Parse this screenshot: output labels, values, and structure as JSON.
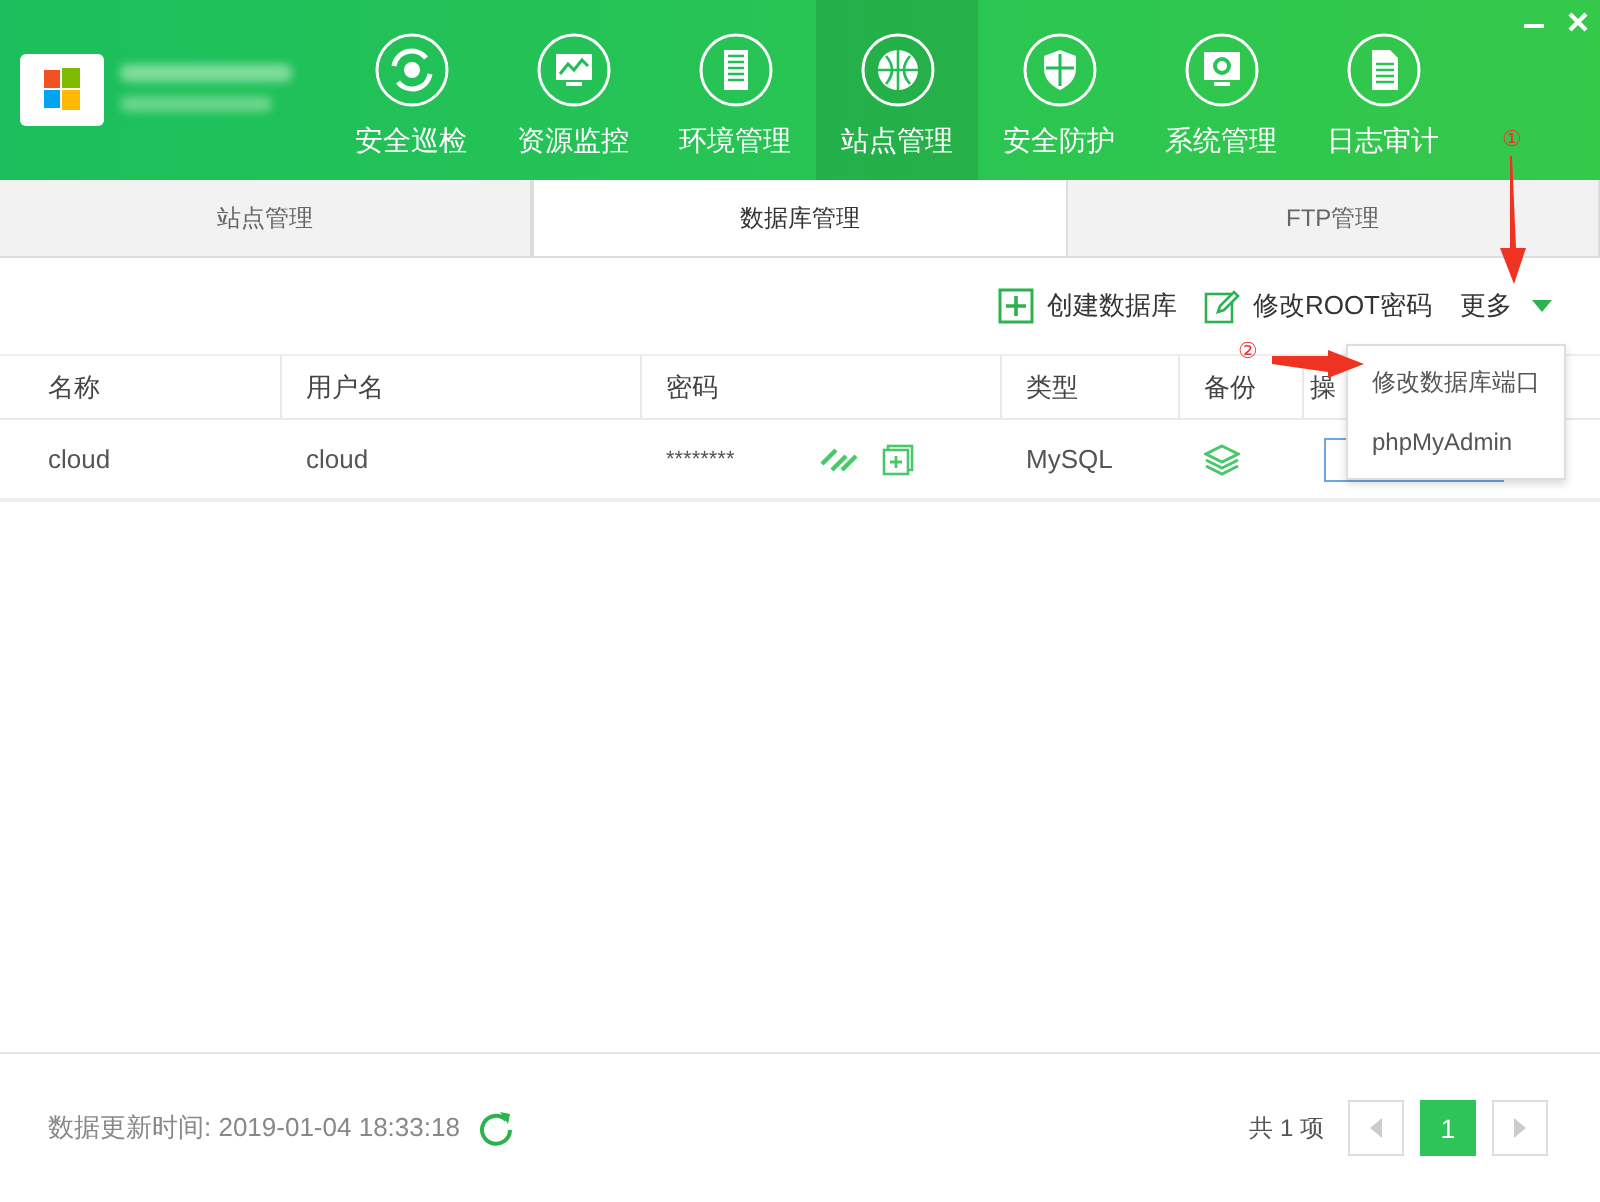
{
  "nav": [
    {
      "label": "安全巡检",
      "kind": "scan",
      "selected": false
    },
    {
      "label": "资源监控",
      "kind": "monitor",
      "selected": false
    },
    {
      "label": "环境管理",
      "kind": "building",
      "selected": false
    },
    {
      "label": "站点管理",
      "kind": "globe",
      "selected": true
    },
    {
      "label": "安全防护",
      "kind": "shield",
      "selected": false
    },
    {
      "label": "系统管理",
      "kind": "system",
      "selected": false
    },
    {
      "label": "日志审计",
      "kind": "doc",
      "selected": false
    }
  ],
  "tabs": [
    {
      "label": "站点管理",
      "selected": false
    },
    {
      "label": "数据库管理",
      "selected": true
    },
    {
      "label": "FTP管理",
      "selected": false
    }
  ],
  "toolbar": [
    {
      "label": "创建数据库",
      "kind": "create"
    },
    {
      "label": "修改ROOT密码",
      "kind": "edit"
    },
    {
      "label": "更多",
      "kind": "more"
    }
  ],
  "table": {
    "columns": [
      "名称",
      "用户名",
      "密码",
      "类型",
      "备份",
      "操"
    ],
    "rows": [
      {
        "name": "cloud",
        "username": "cloud",
        "password": "********",
        "type": "MySQL"
      }
    ]
  },
  "dropdown": {
    "items": [
      "修改数据库端口",
      "phpMyAdmin"
    ]
  },
  "annotations": [
    "①",
    "②"
  ],
  "footer": {
    "updated": "数据更新时间: 2019-01-04 18:33:18",
    "total": "共 1 项",
    "pages": [
      {
        "label": "1",
        "selected": true
      }
    ]
  }
}
